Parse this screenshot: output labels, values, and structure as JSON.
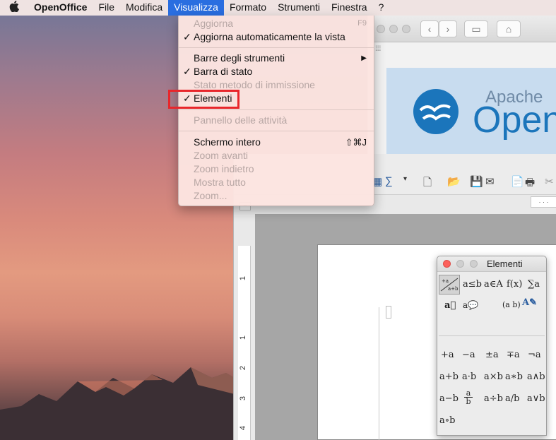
{
  "menubar": {
    "apple_icon": "apple-icon",
    "app_name": "OpenOffice",
    "items": [
      {
        "label": "File"
      },
      {
        "label": "Modifica"
      },
      {
        "label": "Visualizza"
      },
      {
        "label": "Formato"
      },
      {
        "label": "Strumenti"
      },
      {
        "label": "Finestra"
      },
      {
        "label": "?"
      }
    ],
    "active_menu": "Visualizza"
  },
  "view_menu": {
    "items": [
      {
        "label": "Aggiorna",
        "checked": false,
        "enabled": false,
        "shortcut": "F9"
      },
      {
        "label": "Aggiorna automaticamente la vista",
        "checked": true,
        "enabled": true,
        "shortcut": ""
      },
      {
        "label": "Barre degli strumenti",
        "checked": false,
        "enabled": true,
        "submenu": true,
        "shortcut": "▶"
      },
      {
        "label": "Barra di stato",
        "checked": true,
        "enabled": true,
        "shortcut": ""
      },
      {
        "label": "Stato metodo di immissione",
        "checked": false,
        "enabled": false,
        "shortcut": ""
      },
      {
        "label": "Elementi",
        "checked": true,
        "enabled": true,
        "highlighted": true,
        "shortcut": ""
      },
      {
        "label": "Pannello delle attività",
        "checked": false,
        "enabled": false,
        "shortcut": ""
      },
      {
        "label": "Schermo intero",
        "checked": false,
        "enabled": true,
        "shortcut": "⇧⌘J"
      },
      {
        "label": "Zoom avanti",
        "checked": false,
        "enabled": false,
        "shortcut": ""
      },
      {
        "label": "Zoom indietro",
        "checked": false,
        "enabled": false,
        "shortcut": ""
      },
      {
        "label": "Mostra tutto",
        "checked": false,
        "enabled": false,
        "shortcut": ""
      },
      {
        "label": "Zoom...",
        "checked": false,
        "enabled": false,
        "shortcut": ""
      }
    ],
    "check_glyph": "✓",
    "highlight_color": "#e8262b"
  },
  "start_center": {
    "apache_text": "Apache",
    "open_text": "Open",
    "brand_color": "#1b75bb"
  },
  "elements_panel": {
    "title": "Elementi",
    "categories": [
      {
        "label": "+a/a+b",
        "selected": true
      },
      {
        "label": "a≤b"
      },
      {
        "label": "a∈A"
      },
      {
        "label": "f(x)"
      },
      {
        "label": "∑a"
      },
      {
        "label": "a⃗"
      },
      {
        "label": "a💬"
      },
      {
        "label": "(a b)"
      },
      {
        "label": "A✎"
      }
    ],
    "symbols": [
      "+a",
      "−a",
      "±a",
      "∓a",
      "¬a",
      "a+b",
      "a·b",
      "a×b",
      "a∗b",
      "a∧b",
      "a−b",
      "a/b",
      "a÷b",
      "a/b",
      "a∨b",
      "a∘b"
    ]
  },
  "ruler": {
    "top_marks": "· · ·",
    "left_numbers": [
      "1",
      "1",
      "2",
      "3",
      "4"
    ]
  }
}
